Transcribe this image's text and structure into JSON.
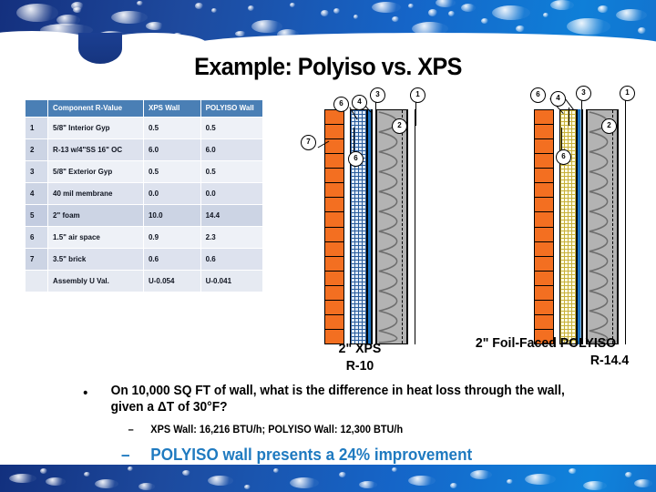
{
  "slide": {
    "title": "Example: Polyiso vs. XPS",
    "accent_color": "#1f7ac0",
    "header_color": "#4a7fb5"
  },
  "table": {
    "headers": [
      "",
      "Component R-Value",
      "XPS Wall",
      "POLYISO Wall"
    ],
    "rows": [
      {
        "idx": "1",
        "component": "5/8\" Interior Gyp",
        "xps": "0.5",
        "poly": "0.5"
      },
      {
        "idx": "2",
        "component": "R-13 w/4\"SS 16\" OC",
        "xps": "6.0",
        "poly": "6.0"
      },
      {
        "idx": "3",
        "component": "5/8\" Exterior Gyp",
        "xps": "0.5",
        "poly": "0.5"
      },
      {
        "idx": "4",
        "component": "40 mil membrane",
        "xps": "0.0",
        "poly": "0.0"
      },
      {
        "idx": "5",
        "component": "2\" foam",
        "xps": "10.0",
        "poly": "14.4"
      },
      {
        "idx": "6",
        "component": "1.5\" air space",
        "xps": "0.9",
        "poly": "2.3"
      },
      {
        "idx": "7",
        "component": "3.5\" brick",
        "xps": "0.6",
        "poly": "0.6"
      },
      {
        "idx": "",
        "component": "Assembly U Val.",
        "xps": "U-0.054",
        "poly": "U-0.041"
      }
    ]
  },
  "diagrams": {
    "xps": {
      "caption_line1": "2\" XPS",
      "caption_line2": "R-10",
      "callouts": [
        "7",
        "6",
        "6",
        "4",
        "3",
        "2",
        "1"
      ]
    },
    "polyiso": {
      "caption_line1": "2\" Foil-Faced POLYISO",
      "caption_line2": "R-14.4",
      "callouts": [
        "6",
        "6",
        "4",
        "3",
        "2",
        "1"
      ]
    }
  },
  "bullets": {
    "bullet_mark": "•",
    "dash_mark": "–",
    "main": "On 10,000 SQ FT of wall, what is the difference in heat loss through the wall, given a ΔT of 30°F?",
    "sub1": "XPS Wall:  16,216 BTU/h; POLYISO Wall: 12,300 BTU/h",
    "sub2": "POLYISO wall presents a 24% improvement"
  }
}
